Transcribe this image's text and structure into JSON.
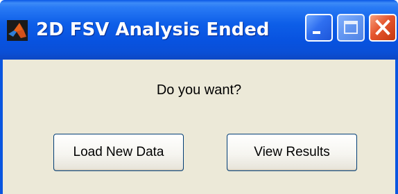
{
  "window": {
    "title": "2D FSV Analysis Ended",
    "app_icon": "matlab-icon",
    "controls": {
      "minimize": "minimize-icon",
      "maximize": "maximize-icon",
      "close": "close-icon"
    }
  },
  "dialog": {
    "prompt": "Do you want?",
    "buttons": {
      "load_new_data": "Load New Data",
      "view_results": "View Results"
    }
  },
  "colors": {
    "titlebar": "#0a56e0",
    "client_bg": "#ece9d8",
    "close_button": "#e5552e",
    "button_border": "#003c74"
  }
}
